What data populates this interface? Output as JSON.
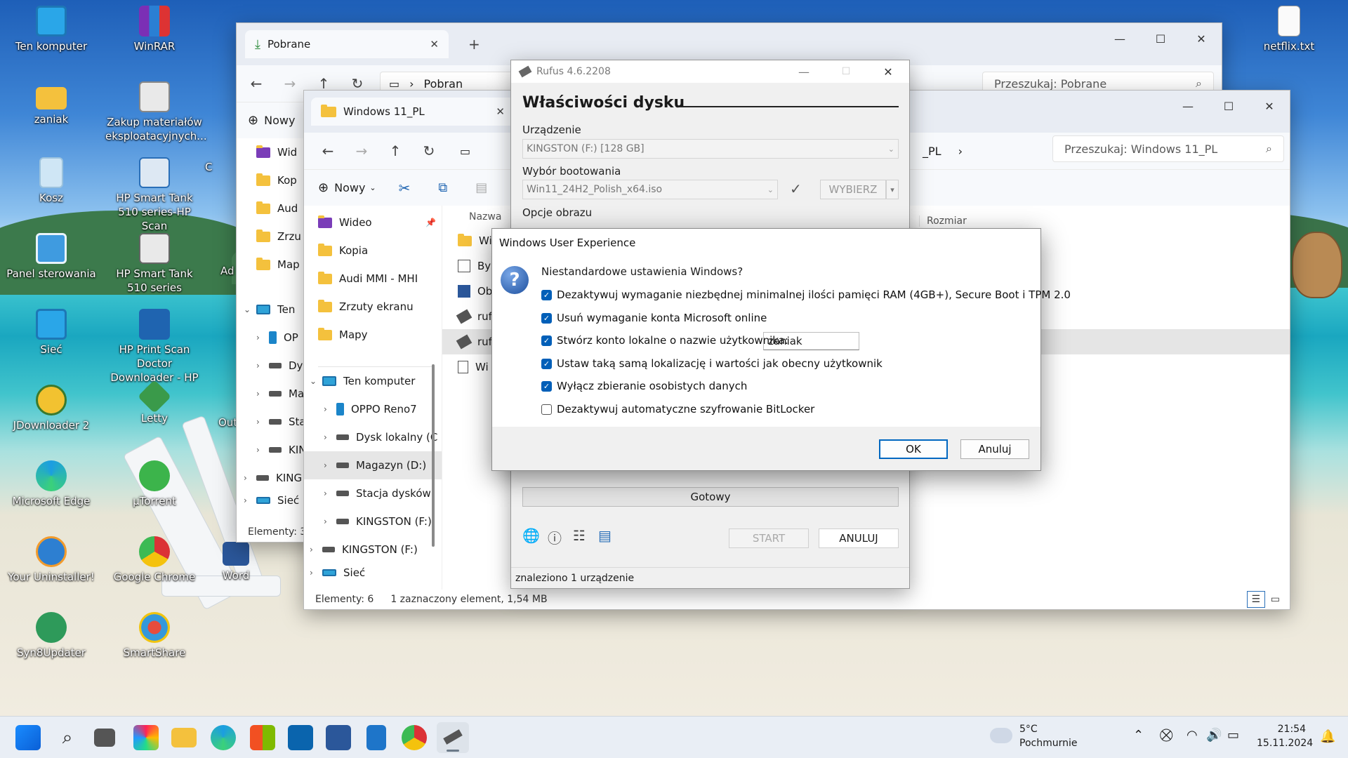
{
  "desktop": {
    "icons_left": [
      {
        "label": "Ten komputer"
      },
      {
        "label": "zaniak"
      },
      {
        "label": "Kosz"
      },
      {
        "label": "Panel sterowania"
      },
      {
        "label": "Sieć"
      },
      {
        "label": "JDownloader 2"
      },
      {
        "label": "Microsoft Edge"
      },
      {
        "label": "Your Uninstaller!"
      },
      {
        "label": "Syn8Updater"
      }
    ],
    "icons_mid": [
      {
        "label": "WinRAR"
      },
      {
        "label": "Zakup materiałów eksploatacyjnych..."
      },
      {
        "label": "HP Smart Tank 510 series-HP Scan"
      },
      {
        "label": "HP Smart Tank 510 series"
      },
      {
        "label": "HP Print Scan Doctor Downloader - HP S..."
      },
      {
        "label": "Letty"
      },
      {
        "label": "µTorrent"
      },
      {
        "label": "Google Chrome"
      },
      {
        "label": "SmartShare"
      }
    ],
    "partial_labels": {
      "ad": "Ad",
      "out": "Out",
      "word": "Word",
      "c": "C"
    },
    "icon_right": {
      "label": "netflix.txt"
    }
  },
  "explorer_back": {
    "tab_title": "Pobrane",
    "address": "Pobran",
    "search_placeholder": "Przeszukaj: Pobrane",
    "new_label": "Nowy",
    "sidebar": [
      "Wid",
      "Kop",
      "Aud",
      "Zrzu",
      "Map",
      "Ten",
      "OP",
      "Dy",
      "Ma",
      "Sta",
      "KIN",
      "KING",
      "Sieć"
    ],
    "status": "Elementy: 3"
  },
  "explorer_front": {
    "tab_title": "Windows 11_PL",
    "address_tail": "_PL",
    "search_placeholder": "Przeszukaj: Windows 11_PL",
    "new_label": "Nowy",
    "col_name": "Nazwa",
    "col_size": "Rozmiar",
    "sidebar": {
      "quick": [
        "Wideo",
        "Kopia",
        "Audi MMI - MHI",
        "Zrzuty ekranu",
        "Mapy"
      ],
      "this_pc": "Ten komputer",
      "drives": [
        "OPPO Reno7",
        "Dysk lokalny (C",
        "Magazyn (D:)",
        "Stacja dysków",
        "KINGSTON (F:)"
      ],
      "usb": "KINGSTON (F:)",
      "network": "Sieć"
    },
    "files": [
      "Wi",
      "Byp",
      "Ob",
      "ruf",
      "ruf",
      "Wi"
    ],
    "status_count": "Elementy: 6",
    "status_selected": "1 zaznaczony element, 1,54 MB"
  },
  "rufus": {
    "title": "Rufus 4.6.2208",
    "section": "Właściwości dysku",
    "device_label": "Urządzenie",
    "device_value": "KINGSTON (F:) [128 GB]",
    "boot_label": "Wybór bootowania",
    "boot_value": "Win11_24H2_Polish_x64.iso",
    "select_button": "WYBIERZ",
    "image_options_label": "Opcje obrazu",
    "status_bar_text": "Gotowy",
    "start_button": "START",
    "cancel_button": "ANULUJ",
    "footer_status": "znaleziono 1 urządzenie"
  },
  "dialog": {
    "title": "Windows User Experience",
    "question": "Niestandardowe ustawienia Windows?",
    "options": [
      {
        "label": "Dezaktywuj wymaganie niezbędnej minimalnej ilości pamięci RAM (4GB+), Secure Boot i TPM 2.0",
        "checked": true
      },
      {
        "label": "Usuń wymaganie konta Microsoft online",
        "checked": true
      },
      {
        "label": "Stwórz konto lokalne o nazwie użytkownika:",
        "checked": true
      },
      {
        "label": "Ustaw taką samą lokalizację i wartości jak obecny użytkownik",
        "checked": true
      },
      {
        "label": "Wyłącz zbieranie osobistych danych",
        "checked": true
      },
      {
        "label": "Dezaktywuj automatyczne szyfrowanie BitLocker",
        "checked": false
      }
    ],
    "username_value": "zaniak",
    "ok_label": "OK",
    "cancel_label": "Anuluj"
  },
  "taskbar": {
    "weather_temp": "5°C",
    "weather_desc": "Pochmurnie",
    "time": "21:54",
    "date": "15.11.2024"
  },
  "colors": {
    "accent": "#005fb8",
    "folder": "#f4c13d"
  }
}
